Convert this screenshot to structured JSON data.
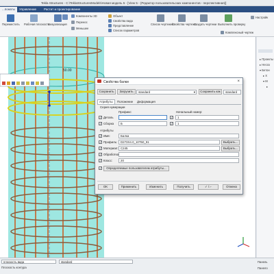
{
  "app": {
    "title": "Tekla Structures - C:\\TeklaStructuresModels\\Новая модель 5 - [View 5 - (Редактор пользовательских компонентов - перспективная)]"
  },
  "ribbon_tabs": [
    "...понаты",
    "Управление",
    "Растит и проектирование"
  ],
  "ribbon": {
    "btn_plane": "Переместить",
    "btn_workplane": "Рабочая плоскость",
    "btn_view": "Визуализация",
    "btn_props": "Свойства",
    "small": [
      "Компоненты 3D",
      "Перенос",
      "Меньшее",
      "Объект",
      "Свойства вида",
      "Представление",
      "Список параметров"
    ],
    "btn_drawings": "Список чертежей",
    "btn_drawprops": "Свойства чертежа",
    "btn_create": "Создать чертежи",
    "btn_run": "Выполнить проверку",
    "btn_complex": "Комплексный чертеж",
    "btn_settings": "Настройк"
  },
  "viewport": {
    "dimension_label": "50.00"
  },
  "right_panel": {
    "items": [
      "Проекты",
      "Несоз",
      "Бетон"
    ]
  },
  "dialog": {
    "title": "Свойства балки",
    "save_btn": "Сохранить",
    "load_btn": "Загрузить",
    "preset_value": "standard",
    "saveas_btn": "Сохранить как",
    "saveas_value": "standard",
    "tabs": [
      "Атрибуты",
      "Положение",
      "Деформация"
    ],
    "section_numbering": "Серия нумерации",
    "col_prefix": "Префикс:",
    "col_start": "Начальный номер:",
    "row_part": "Деталь",
    "row_part_prefix": "",
    "row_part_start": "1",
    "row_assembly": "Сборка",
    "row_assembly_prefix": "Б",
    "row_assembly_start": "1",
    "section_attributes": "Атрибуты",
    "name_label": "Имя:",
    "name_value": "Балка",
    "profile_label": "Профиль:",
    "profile_value": "D273X4.0_10Т50_91",
    "material_label": "Материал:",
    "material_value": "C245",
    "finish_label": "Обработка:",
    "finish_value": "",
    "class_label": "Класс:",
    "class_value": "20",
    "choose_btn": "Выбрать...",
    "udf_btn": "Определяемые пользователем атрибуты...",
    "ok_btn": "OK",
    "apply_btn": "Применить",
    "modify_btn": "Изменить",
    "get_btn": "Получить",
    "toggle_btn": "✓ / ⌐",
    "cancel_btn": "Отмена"
  },
  "status": {
    "view_plane": "плоскость вида",
    "contour_plane": "Плоскость контура",
    "standard": "standard",
    "panel": "Панель",
    "bottom_right": "Панело"
  },
  "colors": {
    "accent": "#2b4f82",
    "concrete": "#4fd3c8",
    "rebar": "#c07a4a",
    "hoop": "#d9d21e"
  }
}
